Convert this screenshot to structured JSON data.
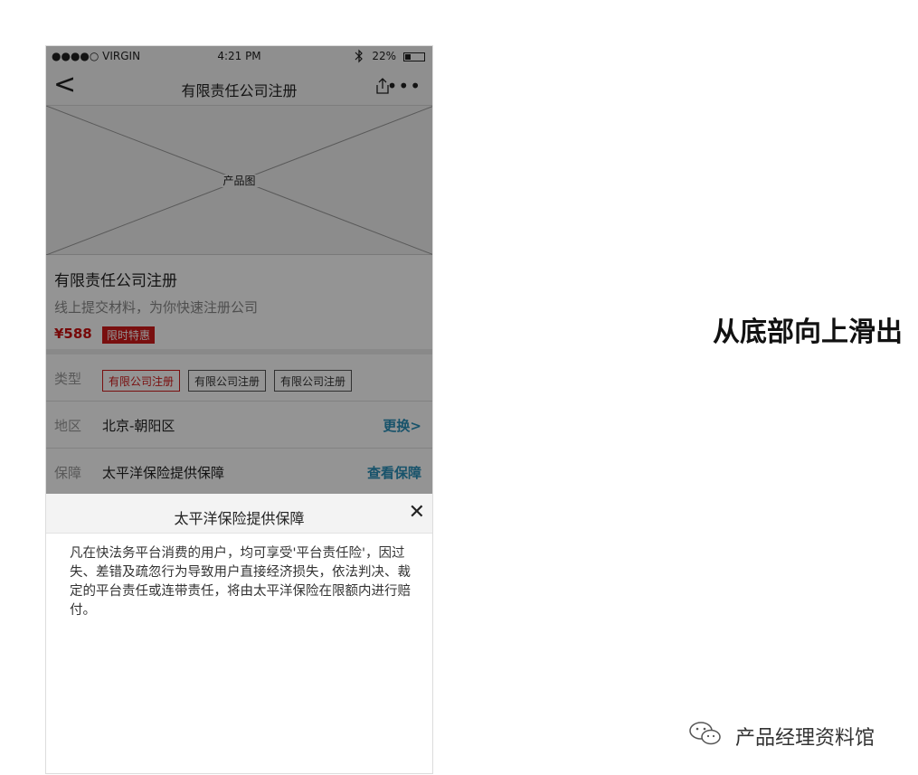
{
  "status_bar": {
    "carrier": "●●●●○ VIRGIN",
    "wifi_icon": "wifi-icon",
    "time": "4:21 PM",
    "bluetooth_icon": "bluetooth-icon",
    "battery": "22%"
  },
  "nav": {
    "back": "<",
    "title": "有限责任公司注册",
    "share_icon": "share-icon",
    "more": "•••"
  },
  "product_image": {
    "label": "产品图"
  },
  "product": {
    "title": "有限责任公司注册",
    "subtitle": "线上提交材料，为你快速注册公司",
    "price": "¥588",
    "badge": "限时特惠"
  },
  "options": {
    "type": {
      "label": "类型",
      "chips": [
        {
          "text": "有限公司注册",
          "selected": true
        },
        {
          "text": "有限公司注册",
          "selected": false
        },
        {
          "text": "有限公司注册",
          "selected": false
        }
      ]
    },
    "region": {
      "label": "地区",
      "value": "北京-朝阳区",
      "action": "更换>"
    },
    "guarantee": {
      "label": "保障",
      "value": "太平洋保险提供保障",
      "action": "查看保障"
    }
  },
  "sheet": {
    "title": "太平洋保险提供保障",
    "close": "✕",
    "body": "凡在快法务平台消费的用户，均可享受'平台责任险'，因过失、差错及疏忽行为导致用户直接经济损失，依法判决、裁定的平台责任或连带责任，将由太平洋保险在限额内进行赔付。"
  },
  "caption": "从底部向上滑出",
  "watermark": "产品经理资料馆",
  "colors": {
    "accent_red": "#d01b1b",
    "link_blue": "#2a90b8"
  }
}
